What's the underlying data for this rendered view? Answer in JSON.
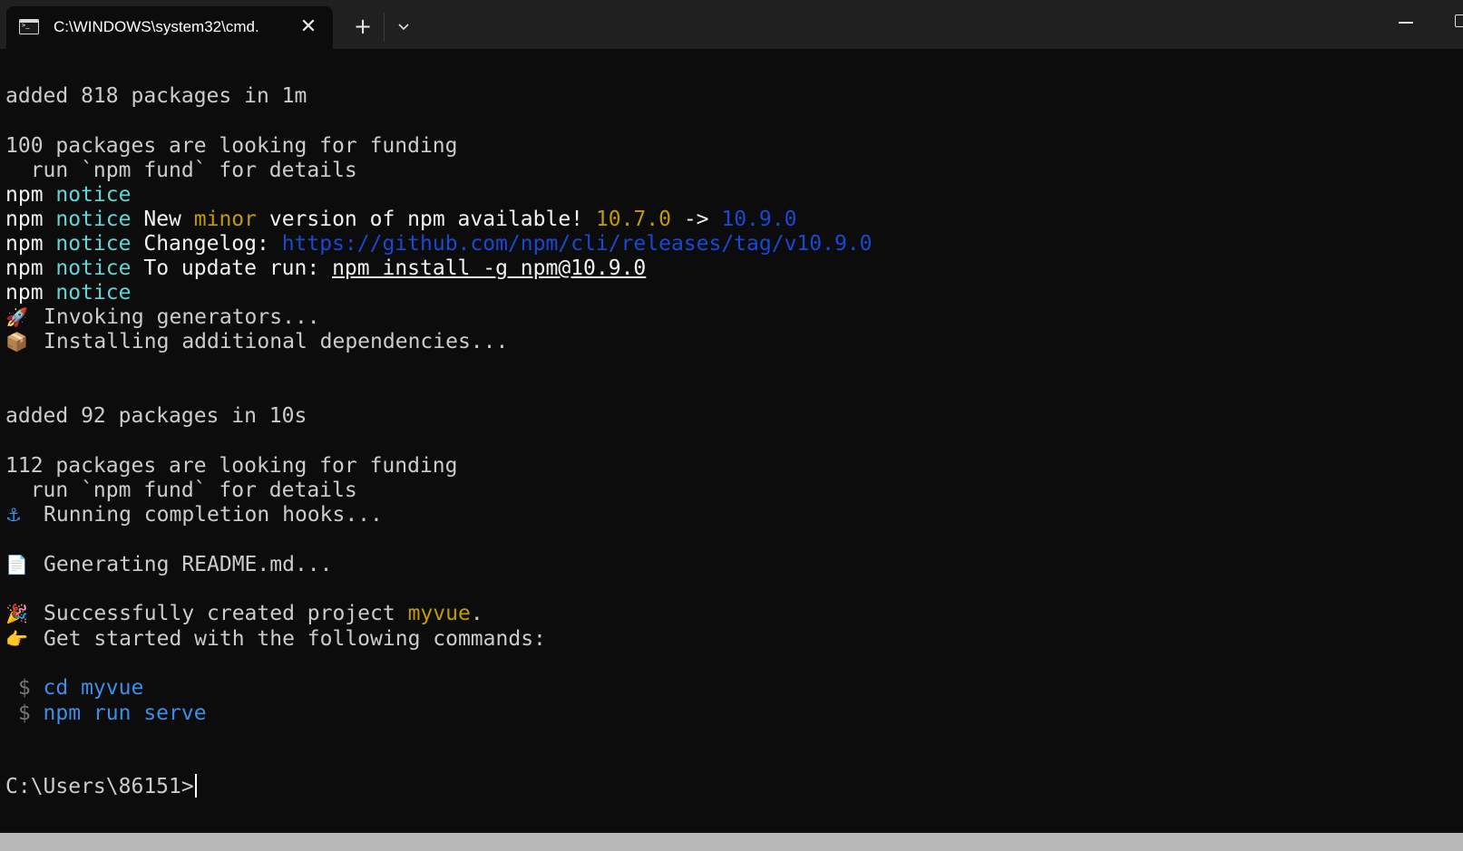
{
  "titlebar": {
    "tab_title": "C:\\WINDOWS\\system32\\cmd.",
    "close_glyph": "✕",
    "new_tab_glyph": "+"
  },
  "terminal": {
    "l1": "added 818 packages in 1m",
    "l2": "100 packages are looking for funding",
    "l3": "  run `npm fund` for details",
    "npm": "npm",
    "notice": "notice",
    "l5_new": "New ",
    "l5_minor": "minor",
    "l5_mid": " version of npm available! ",
    "l5_old_ver": "10.7.0",
    "l5_arrow": " -> ",
    "l5_new_ver": "10.9.0",
    "l6_changelog": "Changelog: ",
    "l6_url": "https://github.com/npm/cli/releases/tag/v10.9.0",
    "l7_update": "To update run: ",
    "l7_cmd": "npm install -g npm@10.9.0",
    "rocket": "🚀",
    "l9_text": "Invoking generators...",
    "package_emoji": "📦",
    "l10_text": "Installing additional dependencies...",
    "l11": "added 92 packages in 10s",
    "l12": "112 packages are looking for funding",
    "l13": "  run `npm fund` for details",
    "anchor": "⚓",
    "l14_text": "Running completion hooks...",
    "doc_emoji": "📄",
    "l15_text": "Generating README.md...",
    "party": "🎉",
    "l16_text": "Successfully created project ",
    "l16_project": "myvue",
    "l16_end": ".",
    "pointer": "👉",
    "l17_text": "Get started with the following commands:",
    "dollar": " $ ",
    "cmd1": "cd myvue",
    "cmd2": "npm run serve",
    "prompt": "C:\\Users\\86151>"
  }
}
